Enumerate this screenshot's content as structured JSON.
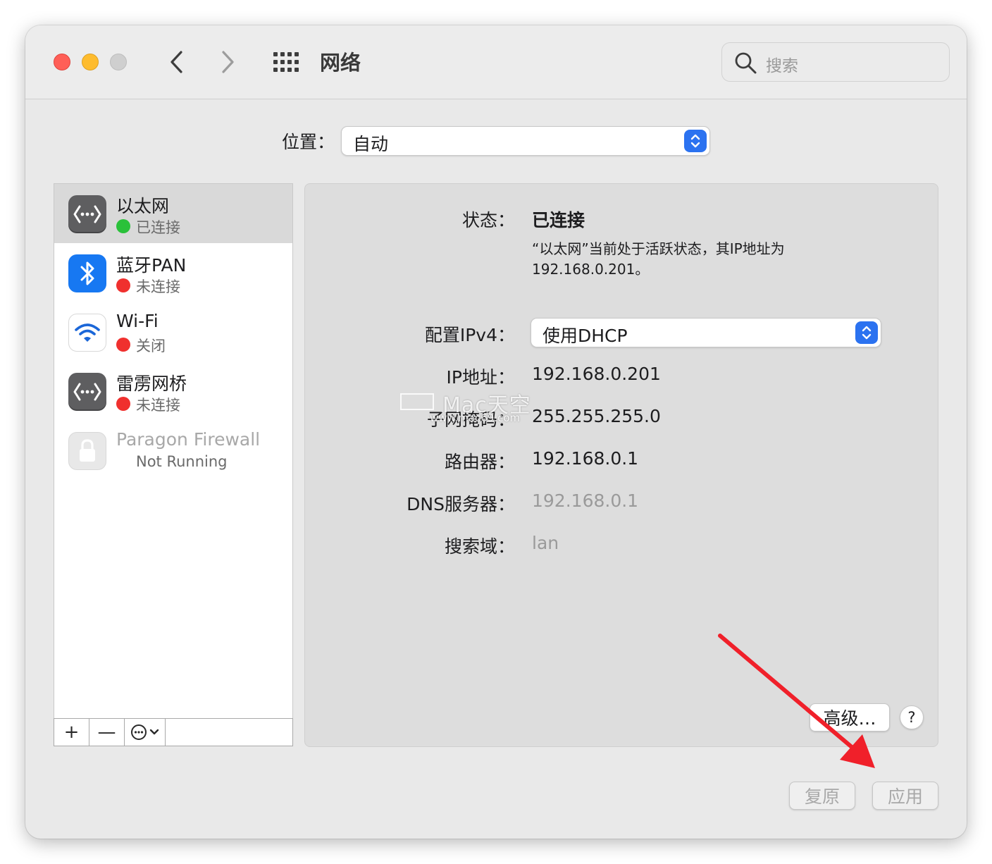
{
  "window": {
    "title": "网络",
    "search_placeholder": "搜索"
  },
  "location": {
    "label": "位置：",
    "value": "自动"
  },
  "services": [
    {
      "name": "以太网",
      "status": "已连接",
      "status_color": "#2ac13a",
      "icon": "ethernet-icon",
      "selected": true
    },
    {
      "name": "蓝牙PAN",
      "status": "未连接",
      "status_color": "#f0302e",
      "icon": "bluetooth-icon"
    },
    {
      "name": "Wi-Fi",
      "status": "关闭",
      "status_color": "#f0302e",
      "icon": "wifi-icon"
    },
    {
      "name": "雷雳网桥",
      "status": "未连接",
      "status_color": "#f0302e",
      "icon": "thunderbolt-bridge-icon"
    },
    {
      "name": "Paragon Firewall",
      "status": "Not Running",
      "icon": "lock-icon",
      "disabled": true
    }
  ],
  "sidebar_toolbar": {
    "add": "+",
    "remove": "—"
  },
  "detail": {
    "status_label": "状态：",
    "status_value": "已连接",
    "status_desc": "“以太网”当前处于活跃状态，其IP地址为192.168.0.201。",
    "ipv4_label": "配置IPv4：",
    "ipv4_value": "使用DHCP",
    "ip_label": "IP地址：",
    "ip_value": "192.168.0.201",
    "subnet_label": "子网掩码：",
    "subnet_value": "255.255.255.0",
    "router_label": "路由器：",
    "router_value": "192.168.0.1",
    "dns_label": "DNS服务器：",
    "dns_value": "192.168.0.1",
    "search_domain_label": "搜索域：",
    "search_domain_value": "lan",
    "advanced_button": "高级…",
    "help_button": "?"
  },
  "footer": {
    "revert_button": "复原",
    "apply_button": "应用"
  },
  "watermark": {
    "main": "Mac天空",
    "sub": "www.mac69.com"
  },
  "colors": {
    "accent": "#2b72f0",
    "annotation_arrow": "#f0202a"
  }
}
